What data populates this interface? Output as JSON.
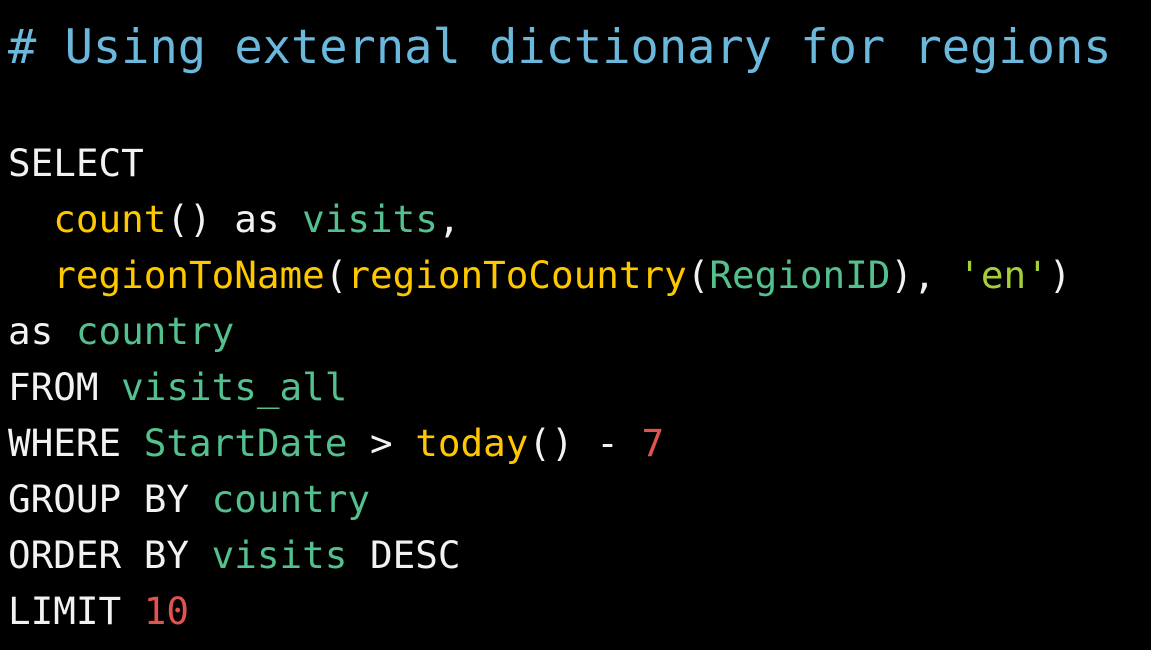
{
  "editor": {
    "background": "#000000",
    "language": "sql",
    "palette": {
      "comment": "#6bb8dd",
      "plain": "#f2f2f2",
      "keyword": "#f2f2f2",
      "function": "#ffc700",
      "identifier": "#54c08e",
      "string": "#a6ce39",
      "number": "#e0534f",
      "punctuation": "#f2f2f2"
    },
    "lines": {
      "comment": "# Using external dictionary for regions",
      "l1": {
        "kw_select": "SELECT"
      },
      "l2": {
        "indent": "  ",
        "fn_count": "count",
        "parens": "()",
        "sp1": " ",
        "kw_as": "as",
        "sp2": " ",
        "id_visits": "visits",
        "comma": ","
      },
      "l3": {
        "indent": "  ",
        "fn_region_to_name": "regionToName",
        "open1": "(",
        "fn_region_to_country": "regionToCountry",
        "open2": "(",
        "id_region_id": "RegionID",
        "close1": ")",
        "comma_sp": ", ",
        "str_en": "'en'",
        "close2": ")"
      },
      "l4": {
        "kw_as": "as",
        "sp": " ",
        "id_country": "country"
      },
      "l5": {
        "kw_from": "FROM",
        "sp": " ",
        "id_visits_all": "visits_all"
      },
      "l6": {
        "kw_where": "WHERE",
        "sp1": " ",
        "id_start_date": "StartDate",
        "sp2": " ",
        "op_gt": ">",
        "sp3": " ",
        "fn_today": "today",
        "parens": "()",
        "sp4": " ",
        "op_minus": "-",
        "sp5": " ",
        "num_7": "7"
      },
      "l7": {
        "kw_group_by": "GROUP BY",
        "sp": " ",
        "id_country": "country"
      },
      "l8": {
        "kw_order_by": "ORDER BY",
        "sp": " ",
        "id_visits": "visits",
        "sp2": " ",
        "kw_desc": "DESC"
      },
      "l9": {
        "kw_limit": "LIMIT",
        "sp": " ",
        "num_10": "10"
      }
    }
  }
}
